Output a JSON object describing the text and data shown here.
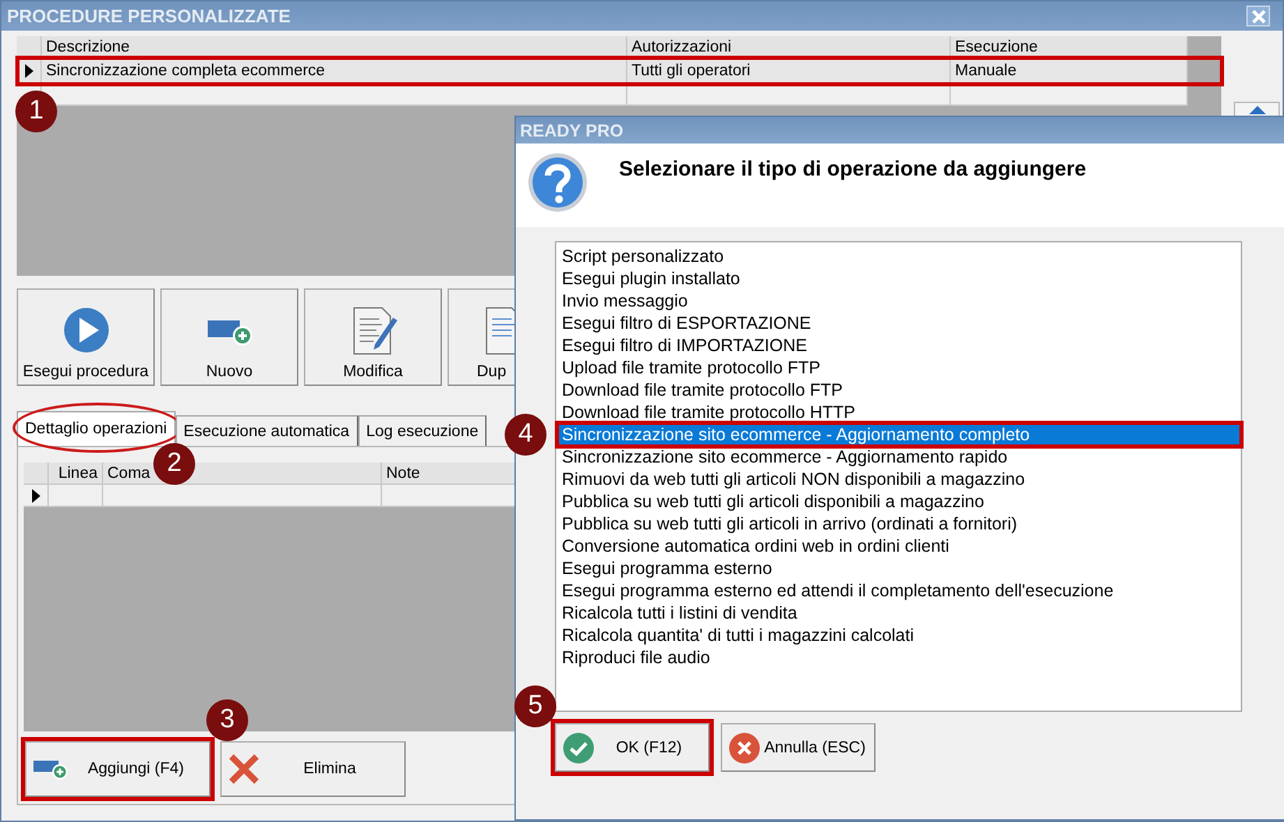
{
  "window": {
    "title": "PROCEDURE PERSONALIZZATE"
  },
  "procedures": {
    "columns": [
      "Descrizione",
      "Autorizzazioni",
      "Esecuzione"
    ],
    "rows": [
      {
        "cells": [
          "Sincronizzazione completa ecommerce",
          "Tutti gli operatori",
          "Manuale"
        ],
        "current": true,
        "highlighted": true,
        "callout": "1"
      }
    ]
  },
  "toolbar": [
    {
      "label": "Esegui procedura",
      "kind": "play"
    },
    {
      "label": "Nuovo",
      "kind": "new"
    },
    {
      "label": "Modifica",
      "kind": "edit"
    },
    {
      "label": "Dup",
      "kind": "copy"
    }
  ],
  "tabs": [
    {
      "label": "Dettaglio operazioni",
      "selected": true,
      "highlighted": true,
      "callout": "2"
    },
    {
      "label": "Esecuzione automatica",
      "selected": false,
      "highlighted": false
    },
    {
      "label": "Log esecuzione",
      "selected": false,
      "highlighted": false
    }
  ],
  "operations": {
    "columns": [
      "Linea",
      "Coma",
      "Note"
    ],
    "rows": [
      {
        "current": true
      }
    ]
  },
  "actions": [
    {
      "label": "Aggiungi (F4)",
      "kind": "add",
      "highlighted": true,
      "callout": "3"
    },
    {
      "label": "Elimina",
      "kind": "delete",
      "highlighted": false
    }
  ],
  "dialog": {
    "title": "READY PRO",
    "message": "Selezionare il tipo di operazione da aggiungere",
    "options": [
      {
        "label": "Script personalizzato",
        "selected": false,
        "highlighted": false
      },
      {
        "label": "Esegui plugin installato",
        "selected": false,
        "highlighted": false
      },
      {
        "label": "Invio messaggio",
        "selected": false,
        "highlighted": false
      },
      {
        "label": "Esegui filtro di ESPORTAZIONE",
        "selected": false,
        "highlighted": false
      },
      {
        "label": "Esegui filtro di IMPORTAZIONE",
        "selected": false,
        "highlighted": false
      },
      {
        "label": "Upload file tramite protocollo FTP",
        "selected": false,
        "highlighted": false
      },
      {
        "label": "Download file tramite protocollo FTP",
        "selected": false,
        "highlighted": false
      },
      {
        "label": "Download file tramite protocollo HTTP",
        "selected": false,
        "highlighted": false
      },
      {
        "label": "Sincronizzazione sito ecommerce - Aggiornamento completo",
        "selected": true,
        "highlighted": true,
        "callout": "4"
      },
      {
        "label": "Sincronizzazione sito ecommerce - Aggiornamento rapido",
        "selected": false,
        "highlighted": false
      },
      {
        "label": "Rimuovi da web tutti gli articoli NON disponibili a magazzino",
        "selected": false,
        "highlighted": false
      },
      {
        "label": "Pubblica su web tutti gli articoli disponibili a magazzino",
        "selected": false,
        "highlighted": false
      },
      {
        "label": "Pubblica su web tutti gli articoli in arrivo (ordinati a fornitori)",
        "selected": false,
        "highlighted": false
      },
      {
        "label": "Conversione automatica ordini web in ordini clienti",
        "selected": false,
        "highlighted": false
      },
      {
        "label": "Esegui programma esterno",
        "selected": false,
        "highlighted": false
      },
      {
        "label": "Esegui programma esterno ed attendi il completamento dell'esecuzione",
        "selected": false,
        "highlighted": false
      },
      {
        "label": "Ricalcola tutti i listini di vendita",
        "selected": false,
        "highlighted": false
      },
      {
        "label": "Ricalcola quantita' di tutti i magazzini calcolati",
        "selected": false,
        "highlighted": false
      },
      {
        "label": "Riproduci file audio",
        "selected": false,
        "highlighted": false
      }
    ],
    "buttons": [
      {
        "label": "OK (F12)",
        "kind": "ok",
        "highlighted": true,
        "callout": "5"
      },
      {
        "label": "Annulla (ESC)",
        "kind": "cancel",
        "highlighted": false
      }
    ]
  }
}
